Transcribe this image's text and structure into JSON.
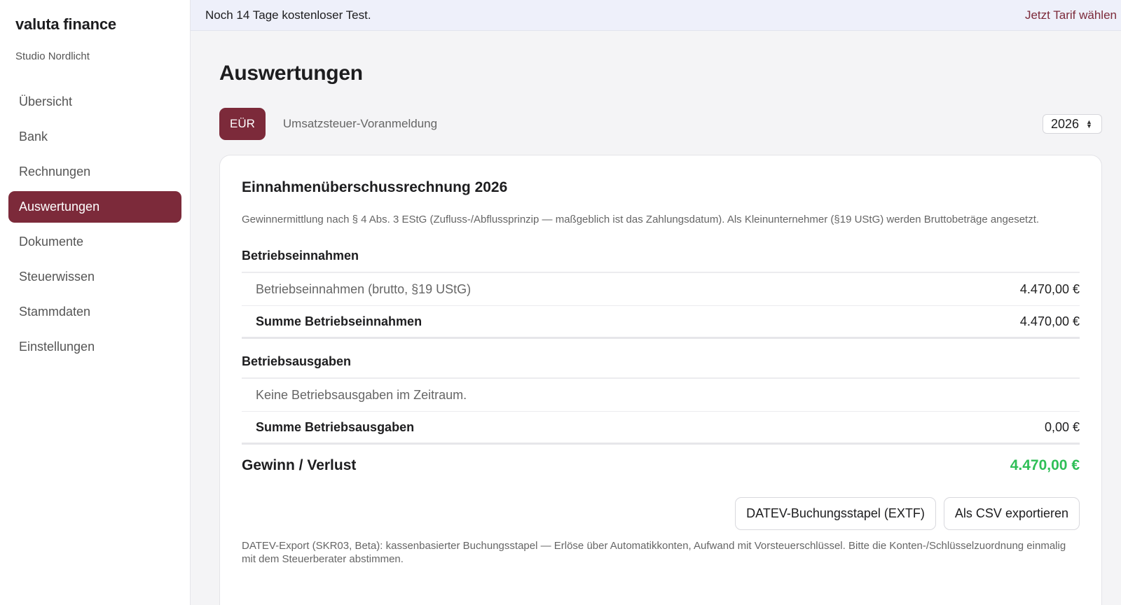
{
  "sidebar": {
    "brand": "valuta finance",
    "org": "Studio Nordlicht",
    "items": [
      {
        "label": "Übersicht"
      },
      {
        "label": "Bank"
      },
      {
        "label": "Rechnungen"
      },
      {
        "label": "Auswertungen"
      },
      {
        "label": "Dokumente"
      },
      {
        "label": "Steuerwissen"
      },
      {
        "label": "Stammdaten"
      },
      {
        "label": "Einstellungen"
      }
    ],
    "active_item": "Auswertungen"
  },
  "trial": {
    "text": "Noch 14 Tage kostenloser Test.",
    "link": "Jetzt Tarif wählen"
  },
  "page": {
    "title": "Auswertungen"
  },
  "tabs": [
    {
      "label": "EÜR",
      "active": true
    },
    {
      "label": "Umsatzsteuer-Voranmeldung",
      "active": false
    }
  ],
  "year_select": {
    "value": "2026"
  },
  "card": {
    "title": "Einnahmenüberschussrechnung 2026",
    "description": "Gewinnermittlung nach § 4 Abs. 3 EStG (Zufluss-/Abflussprinzip — maßgeblich ist das Zahlungsdatum). Als Kleinunternehmer (§19 UStG) werden Bruttobeträge angesetzt.",
    "income": {
      "title": "Betriebseinnahmen",
      "row_label": "Betriebseinnahmen (brutto, §19 UStG)",
      "row_value": "4.470,00 €",
      "sum_label": "Summe Betriebseinnahmen",
      "sum_value": "4.470,00 €"
    },
    "expenses": {
      "title": "Betriebsausgaben",
      "empty_text": "Keine Betriebsausgaben im Zeitraum.",
      "sum_label": "Summe Betriebsausgaben",
      "sum_value": "0,00 €"
    },
    "result": {
      "label": "Gewinn / Verlust",
      "value": "4.470,00 €"
    },
    "buttons": {
      "datev": "DATEV-Buchungsstapel (EXTF)",
      "csv": "Als CSV exportieren"
    },
    "footnote": "DATEV-Export (SKR03, Beta): kassenbasierter Buchungsstapel — Erlöse über Automatikkonten, Aufwand mit Vorsteuerschlüssel. Bitte die Konten-/Schlüsselzuordnung einmalig mit dem Steuerberater abstimmen."
  },
  "colors": {
    "accent": "#7c2a3a",
    "positive": "#2fbf57",
    "trial_bg": "#eef0fa"
  }
}
